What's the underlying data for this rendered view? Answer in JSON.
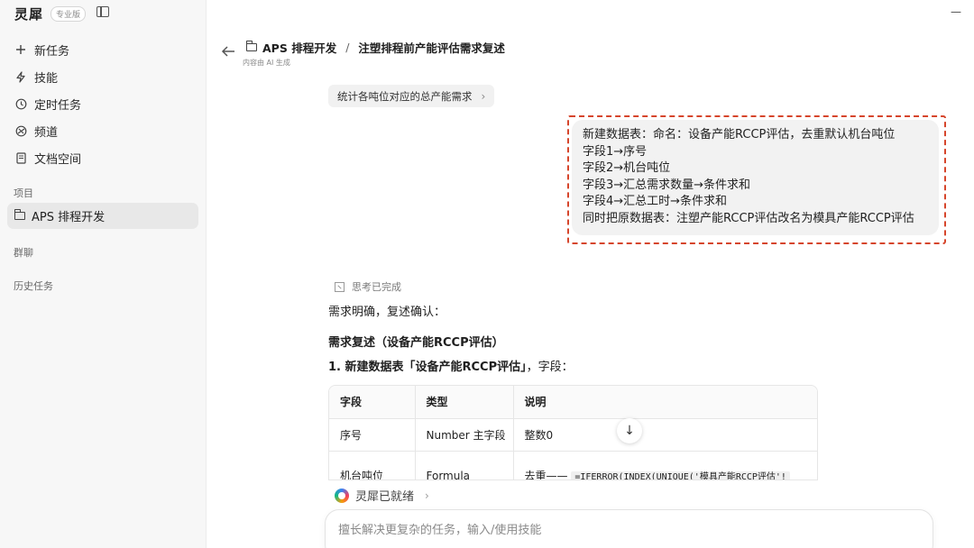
{
  "app": {
    "name": "灵犀",
    "edition": "专业版"
  },
  "window": {
    "minimize": "—"
  },
  "sidebar": {
    "nav": [
      {
        "icon": "plus-icon",
        "label": "新任务"
      },
      {
        "icon": "lightning-icon",
        "label": "技能"
      },
      {
        "icon": "clock-icon",
        "label": "定时任务"
      },
      {
        "icon": "channel-icon",
        "label": "频道"
      },
      {
        "icon": "document-icon",
        "label": "文档空间"
      }
    ],
    "projects_label": "项目",
    "project": "APS 排程开发",
    "groups_label": "群聊",
    "history_label": "历史任务"
  },
  "header": {
    "project": "APS 排程开发",
    "separator": "/",
    "task": "注塑排程前产能评估需求复述",
    "ai_note": "内容由 AI 生成"
  },
  "suggestion": {
    "label": "统计各吨位对应的总产能需求"
  },
  "user_message": [
    "新建数据表：命名：设备产能RCCP评估，去重默认机台吨位",
    "字段1→序号",
    "字段2→机台吨位",
    "字段3→汇总需求数量→条件求和",
    "字段4→汇总工时→条件求和",
    "同时把原数据表：注塑产能RCCP评估改名为模具产能RCCP评估"
  ],
  "answer": {
    "thinking": "思考已完成",
    "intro": "需求明确，复述确认：",
    "heading": "需求复述（设备产能RCCP评估）",
    "step1_bold": "1. 新建数据表「设备产能RCCP评估」",
    "step1_rest": "，字段：",
    "table": {
      "headers": [
        "字段",
        "类型",
        "说明"
      ],
      "rows": [
        {
          "field": "序号",
          "type": "Number 主字段",
          "desc": "整数0",
          "code": ""
        },
        {
          "field": "机台吨位",
          "type": "Formula",
          "desc": "去重——",
          "code": "=IFERROR(INDEX(UNIQUE('模具产能RCCP评估'!"
        }
      ]
    }
  },
  "status": {
    "label": "灵犀已就绪"
  },
  "input": {
    "placeholder": "擅长解决更复杂的任务，输入/使用技能"
  }
}
